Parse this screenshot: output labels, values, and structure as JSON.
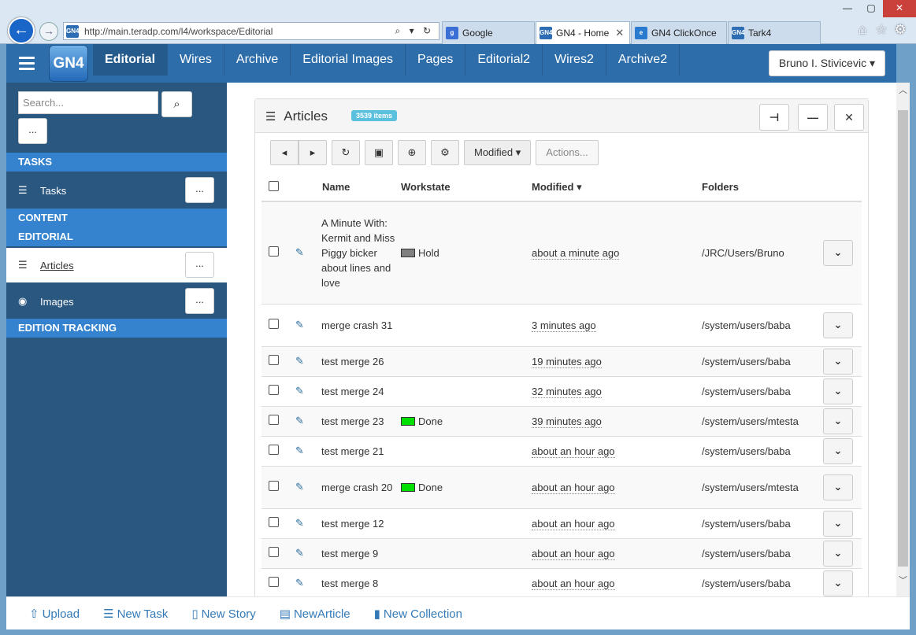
{
  "browser": {
    "url": "http://main.teradp.com/l4/workspace/Editorial",
    "favicon": "GN4",
    "tabs": [
      {
        "label": "Google",
        "icon": "g",
        "color": "#3b6fd6",
        "active": false
      },
      {
        "label": "GN4 - Home",
        "icon": "GN4",
        "color": "#2d6db3",
        "active": true,
        "close": "✕"
      },
      {
        "label": "GN4 ClickOnce",
        "icon": "e",
        "color": "#2a7ad0",
        "active": false
      },
      {
        "label": "Tark4",
        "icon": "GN4",
        "color": "#2d6db3",
        "active": false
      }
    ],
    "window_controls": {
      "minimize": "—",
      "maximize": "▢",
      "close": "✕"
    },
    "tool_icons": {
      "home": "⌂",
      "favorites": "☆",
      "settings": "⚙"
    },
    "address_tools": "⌕ ▾ ↻",
    "back_icon": "←",
    "forward_icon": "→"
  },
  "appnav": {
    "logo": "GN4",
    "links": [
      "Editorial",
      "Wires",
      "Archive",
      "Editorial Images",
      "Pages",
      "Editorial2",
      "Wires2",
      "Archive2"
    ],
    "active_index": 0,
    "user": "Bruno I. Stivicevic",
    "user_caret": "▾"
  },
  "sidebar": {
    "search_placeholder": "Search...",
    "search_icon": "⌕",
    "more_label": "...",
    "sections": {
      "tasks": "TASKS",
      "content": "CONTENT",
      "editorial": "EDITORIAL",
      "edition_tracking": "EDITION TRACKING"
    },
    "items": {
      "tasks": {
        "label": "Tasks",
        "icon": "☰",
        "dots": "..."
      },
      "articles": {
        "label": "Articles",
        "icon": "☰",
        "dots": "..."
      },
      "images": {
        "label": "Images",
        "icon": "◉",
        "dots": "..."
      }
    }
  },
  "panel": {
    "title": "Articles",
    "title_icon": "☰",
    "badge": "3539 items",
    "head_buttons": {
      "pin": "⊣",
      "minimize": "—",
      "close": "✕"
    },
    "toolbar": {
      "prev": "◂",
      "next": "▸",
      "refresh": "↻",
      "save": "▣",
      "zoom": "⊕",
      "settings": "⚙",
      "sort_label": "Modified",
      "sort_caret": "▾",
      "actions_label": "Actions..."
    },
    "columns": {
      "name": "Name",
      "workstate": "Workstate",
      "modified": "Modified",
      "modified_sort": "▾",
      "folders": "Folders"
    },
    "row_icon": "✎",
    "row_dropdown": "⌄",
    "rows": [
      {
        "name": "A Minute With: Kermit and Miss Piggy bicker about lines and love",
        "workstate": "Hold",
        "ws_color": "#808080",
        "modified": "about a minute ago",
        "folder": "/JRC/Users/Bruno"
      },
      {
        "name": "merge crash 31",
        "workstate": "",
        "ws_color": "",
        "modified": "3 minutes ago",
        "folder": "/system/users/baba"
      },
      {
        "name": "test merge 26",
        "workstate": "",
        "ws_color": "",
        "modified": "19 minutes ago",
        "folder": "/system/users/baba"
      },
      {
        "name": "test merge 24",
        "workstate": "",
        "ws_color": "",
        "modified": "32 minutes ago",
        "folder": "/system/users/baba"
      },
      {
        "name": "test merge 23",
        "workstate": "Done",
        "ws_color": "#00e000",
        "modified": "39 minutes ago",
        "folder": "/system/users/mtesta"
      },
      {
        "name": "test merge 21",
        "workstate": "",
        "ws_color": "",
        "modified": "about an hour ago",
        "folder": "/system/users/baba"
      },
      {
        "name": "merge crash 20",
        "workstate": "Done",
        "ws_color": "#00e000",
        "modified": "about an hour ago",
        "folder": "/system/users/mtesta"
      },
      {
        "name": "test merge 12",
        "workstate": "",
        "ws_color": "",
        "modified": "about an hour ago",
        "folder": "/system/users/baba"
      },
      {
        "name": "test merge 9",
        "workstate": "",
        "ws_color": "",
        "modified": "about an hour ago",
        "folder": "/system/users/baba"
      },
      {
        "name": "test merge 8",
        "workstate": "",
        "ws_color": "",
        "modified": "about an hour ago",
        "folder": "/system/users/baba"
      }
    ]
  },
  "footer": {
    "upload": {
      "label": "Upload",
      "icon": "⇧"
    },
    "new_task": {
      "label": "New Task",
      "icon": "☰"
    },
    "new_story": {
      "label": "New Story",
      "icon": "▯"
    },
    "new_article": {
      "label": "NewArticle",
      "icon": "▤"
    },
    "new_collection": {
      "label": "New Collection",
      "icon": "▮"
    }
  },
  "scrollbar": {
    "up": "︿",
    "down": "﹀"
  }
}
